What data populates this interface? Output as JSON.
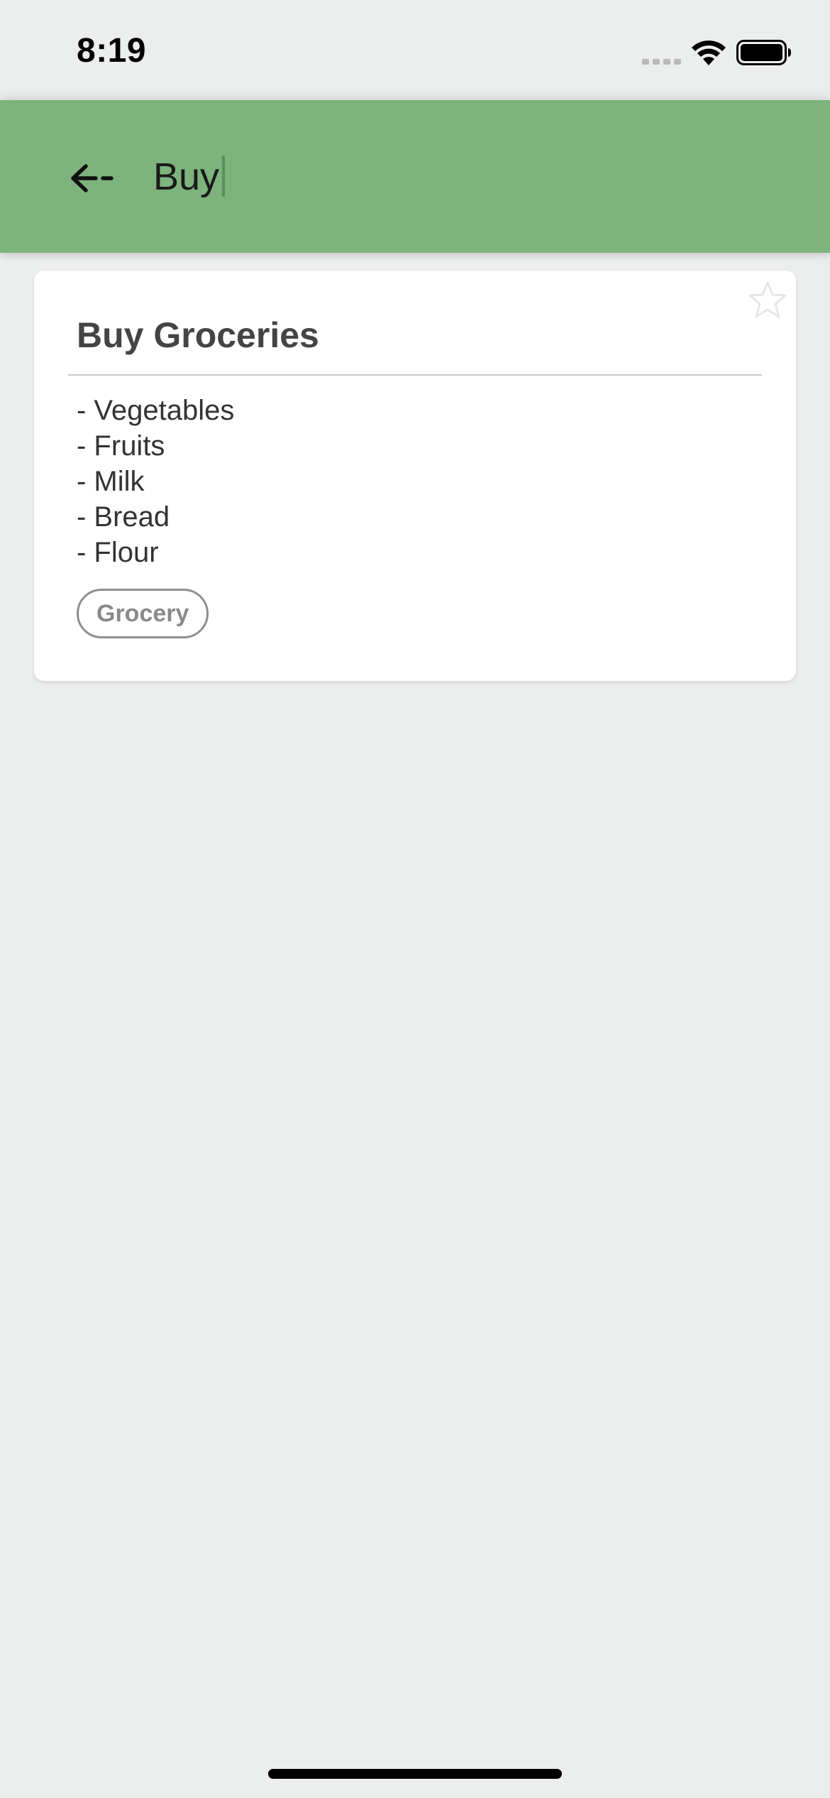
{
  "status_bar": {
    "time": "8:19",
    "icons": [
      "signal-icon",
      "wifi-icon",
      "battery-icon"
    ]
  },
  "header": {
    "background_color": "#7db37d",
    "back_icon": "arrow-left-icon",
    "search_value": "Buy",
    "search_placeholder": ""
  },
  "results": [
    {
      "title": "Buy Groceries",
      "starred": false,
      "lines": [
        "- Vegetables",
        "- Fruits",
        "- Milk",
        "- Bread",
        "- Flour"
      ],
      "tags": [
        "Grocery"
      ]
    }
  ]
}
